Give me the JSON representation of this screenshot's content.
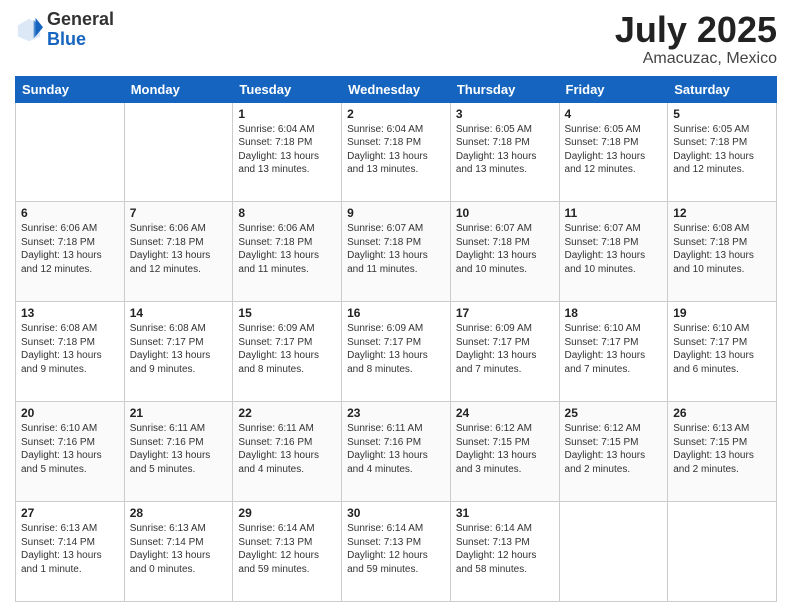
{
  "header": {
    "logo_line1": "General",
    "logo_line2": "Blue",
    "main_title": "July 2025",
    "subtitle": "Amacuzac, Mexico"
  },
  "columns": [
    "Sunday",
    "Monday",
    "Tuesday",
    "Wednesday",
    "Thursday",
    "Friday",
    "Saturday"
  ],
  "rows": [
    [
      {
        "day": "",
        "detail": ""
      },
      {
        "day": "",
        "detail": ""
      },
      {
        "day": "1",
        "detail": "Sunrise: 6:04 AM\nSunset: 7:18 PM\nDaylight: 13 hours\nand 13 minutes."
      },
      {
        "day": "2",
        "detail": "Sunrise: 6:04 AM\nSunset: 7:18 PM\nDaylight: 13 hours\nand 13 minutes."
      },
      {
        "day": "3",
        "detail": "Sunrise: 6:05 AM\nSunset: 7:18 PM\nDaylight: 13 hours\nand 13 minutes."
      },
      {
        "day": "4",
        "detail": "Sunrise: 6:05 AM\nSunset: 7:18 PM\nDaylight: 13 hours\nand 12 minutes."
      },
      {
        "day": "5",
        "detail": "Sunrise: 6:05 AM\nSunset: 7:18 PM\nDaylight: 13 hours\nand 12 minutes."
      }
    ],
    [
      {
        "day": "6",
        "detail": "Sunrise: 6:06 AM\nSunset: 7:18 PM\nDaylight: 13 hours\nand 12 minutes."
      },
      {
        "day": "7",
        "detail": "Sunrise: 6:06 AM\nSunset: 7:18 PM\nDaylight: 13 hours\nand 12 minutes."
      },
      {
        "day": "8",
        "detail": "Sunrise: 6:06 AM\nSunset: 7:18 PM\nDaylight: 13 hours\nand 11 minutes."
      },
      {
        "day": "9",
        "detail": "Sunrise: 6:07 AM\nSunset: 7:18 PM\nDaylight: 13 hours\nand 11 minutes."
      },
      {
        "day": "10",
        "detail": "Sunrise: 6:07 AM\nSunset: 7:18 PM\nDaylight: 13 hours\nand 10 minutes."
      },
      {
        "day": "11",
        "detail": "Sunrise: 6:07 AM\nSunset: 7:18 PM\nDaylight: 13 hours\nand 10 minutes."
      },
      {
        "day": "12",
        "detail": "Sunrise: 6:08 AM\nSunset: 7:18 PM\nDaylight: 13 hours\nand 10 minutes."
      }
    ],
    [
      {
        "day": "13",
        "detail": "Sunrise: 6:08 AM\nSunset: 7:18 PM\nDaylight: 13 hours\nand 9 minutes."
      },
      {
        "day": "14",
        "detail": "Sunrise: 6:08 AM\nSunset: 7:17 PM\nDaylight: 13 hours\nand 9 minutes."
      },
      {
        "day": "15",
        "detail": "Sunrise: 6:09 AM\nSunset: 7:17 PM\nDaylight: 13 hours\nand 8 minutes."
      },
      {
        "day": "16",
        "detail": "Sunrise: 6:09 AM\nSunset: 7:17 PM\nDaylight: 13 hours\nand 8 minutes."
      },
      {
        "day": "17",
        "detail": "Sunrise: 6:09 AM\nSunset: 7:17 PM\nDaylight: 13 hours\nand 7 minutes."
      },
      {
        "day": "18",
        "detail": "Sunrise: 6:10 AM\nSunset: 7:17 PM\nDaylight: 13 hours\nand 7 minutes."
      },
      {
        "day": "19",
        "detail": "Sunrise: 6:10 AM\nSunset: 7:17 PM\nDaylight: 13 hours\nand 6 minutes."
      }
    ],
    [
      {
        "day": "20",
        "detail": "Sunrise: 6:10 AM\nSunset: 7:16 PM\nDaylight: 13 hours\nand 5 minutes."
      },
      {
        "day": "21",
        "detail": "Sunrise: 6:11 AM\nSunset: 7:16 PM\nDaylight: 13 hours\nand 5 minutes."
      },
      {
        "day": "22",
        "detail": "Sunrise: 6:11 AM\nSunset: 7:16 PM\nDaylight: 13 hours\nand 4 minutes."
      },
      {
        "day": "23",
        "detail": "Sunrise: 6:11 AM\nSunset: 7:16 PM\nDaylight: 13 hours\nand 4 minutes."
      },
      {
        "day": "24",
        "detail": "Sunrise: 6:12 AM\nSunset: 7:15 PM\nDaylight: 13 hours\nand 3 minutes."
      },
      {
        "day": "25",
        "detail": "Sunrise: 6:12 AM\nSunset: 7:15 PM\nDaylight: 13 hours\nand 2 minutes."
      },
      {
        "day": "26",
        "detail": "Sunrise: 6:13 AM\nSunset: 7:15 PM\nDaylight: 13 hours\nand 2 minutes."
      }
    ],
    [
      {
        "day": "27",
        "detail": "Sunrise: 6:13 AM\nSunset: 7:14 PM\nDaylight: 13 hours\nand 1 minute."
      },
      {
        "day": "28",
        "detail": "Sunrise: 6:13 AM\nSunset: 7:14 PM\nDaylight: 13 hours\nand 0 minutes."
      },
      {
        "day": "29",
        "detail": "Sunrise: 6:14 AM\nSunset: 7:13 PM\nDaylight: 12 hours\nand 59 minutes."
      },
      {
        "day": "30",
        "detail": "Sunrise: 6:14 AM\nSunset: 7:13 PM\nDaylight: 12 hours\nand 59 minutes."
      },
      {
        "day": "31",
        "detail": "Sunrise: 6:14 AM\nSunset: 7:13 PM\nDaylight: 12 hours\nand 58 minutes."
      },
      {
        "day": "",
        "detail": ""
      },
      {
        "day": "",
        "detail": ""
      }
    ]
  ]
}
